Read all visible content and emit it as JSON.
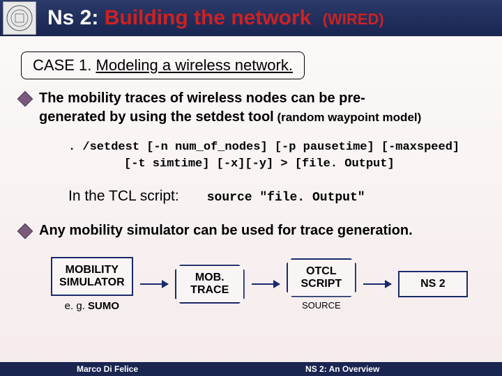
{
  "header": {
    "ns2": "Ns 2:",
    "main": "Building the network",
    "wired": "(WIRED)"
  },
  "case": {
    "prefix": "CASE 1.",
    "text": "Modeling a wireless network."
  },
  "bullet1": {
    "line1": "The mobility traces of wireless nodes can be pre-",
    "line2": "generated by using the setdest tool",
    "line2_small": " (random waypoint model)"
  },
  "code": {
    "l1": ". /setdest [-n num_of_nodes] [-p pausetime] [-maxspeed]",
    "l2": "[-t simtime] [-x][-y] > [file. Output]"
  },
  "tcl": {
    "label": "In the TCL script:",
    "code": "source \"file. Output\""
  },
  "bullet2": "Any mobility simulator can be used for trace generation.",
  "flow": {
    "b1": "MOBILITY\nSIMULATOR",
    "b1_eg": "e. g. SUMO",
    "b2": "MOB.\nTRACE",
    "b3": "OTCL\nSCRIPT",
    "b3_sub": "SOURCE",
    "b4": "NS 2"
  },
  "footer": {
    "left": "Marco Di Felice",
    "right": "NS 2: An Overview"
  }
}
